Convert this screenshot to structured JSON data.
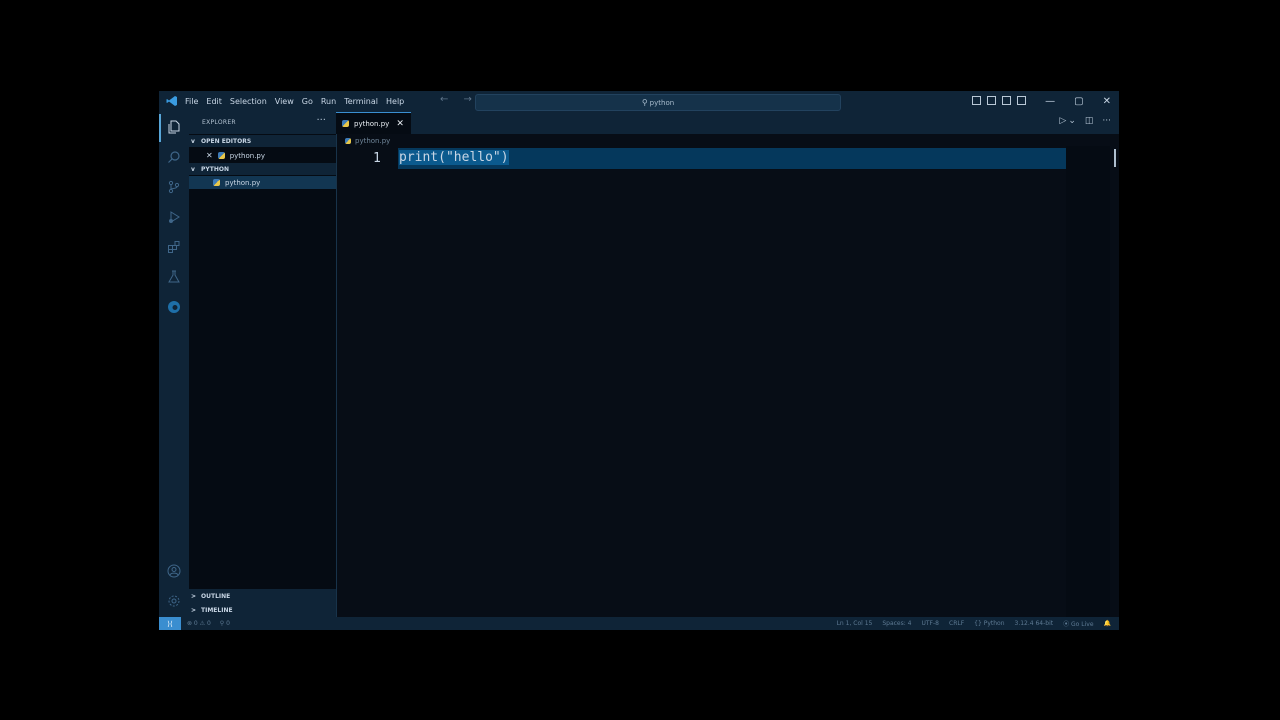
{
  "menu": [
    "File",
    "Edit",
    "Selection",
    "View",
    "Go",
    "Run",
    "Terminal",
    "Help"
  ],
  "nav_arrows": "← →",
  "command_center": {
    "icon": "search-icon",
    "text": "python"
  },
  "window_controls": {
    "minimize": "—",
    "restore": "▢",
    "close": "✕"
  },
  "sidebar": {
    "title": "EXPLORER",
    "more": "···",
    "open_editors_label": "OPEN EDITORS",
    "open_editors": [
      {
        "close": "✕",
        "name": "python.py"
      }
    ],
    "folder_label": "PYTHON",
    "files": [
      {
        "name": "python.py"
      }
    ],
    "outline_label": "OUTLINE",
    "timeline_label": "TIMELINE",
    "chevron_open": "v",
    "chevron_closed": ">"
  },
  "editor": {
    "tab": {
      "label": "python.py",
      "close": "✕"
    },
    "actions": {
      "run": "▷",
      "run_dropdown": "⌄",
      "split": "◫",
      "more": "···"
    },
    "breadcrumb": "python.py",
    "lines": [
      {
        "number": "1",
        "code": "print(\"hello\")"
      }
    ]
  },
  "statusbar": {
    "remote": "⟩⟨",
    "problems": "⊗ 0 ⚠ 0",
    "ports": "⚲ 0",
    "position": "Ln 1, Col 15",
    "spaces": "Spaces: 4",
    "encoding": "UTF-8",
    "eol": "CRLF",
    "language": "{} Python",
    "interpreter": "3.12.4 64-bit",
    "go_live": "⦿ Go Live",
    "notifications": "🔔"
  },
  "colors": {
    "chrome": "#0f2437",
    "editor_bg": "#070d16",
    "line_highlight": "#05385c",
    "accent": "#3a8ed0",
    "text": "#c8d6e5"
  }
}
